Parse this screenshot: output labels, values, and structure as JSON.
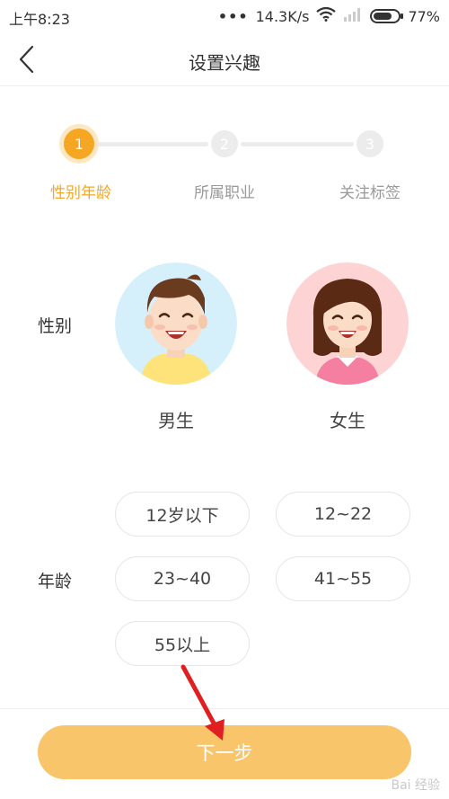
{
  "status_bar": {
    "time": "上午8:23",
    "dots": "•••",
    "network_speed": "14.3K/s",
    "battery_percent": "77%",
    "battery_level": 0.77
  },
  "header": {
    "title": "设置兴趣"
  },
  "steps": [
    {
      "number": "1",
      "label": "性别年龄",
      "active": true
    },
    {
      "number": "2",
      "label": "所属职业",
      "active": false
    },
    {
      "number": "3",
      "label": "关注标签",
      "active": false
    }
  ],
  "gender": {
    "label": "性别",
    "options": [
      {
        "label": "男生"
      },
      {
        "label": "女生"
      }
    ]
  },
  "age": {
    "label": "年龄",
    "options": [
      "12岁以下",
      "12~22",
      "23~40",
      "41~55",
      "55以上"
    ]
  },
  "next_button": {
    "label": "下一步"
  },
  "watermark": "Bai 经验",
  "colors": {
    "accent": "#f5a623",
    "button": "#f8c56b",
    "arrow": "#e02020"
  }
}
